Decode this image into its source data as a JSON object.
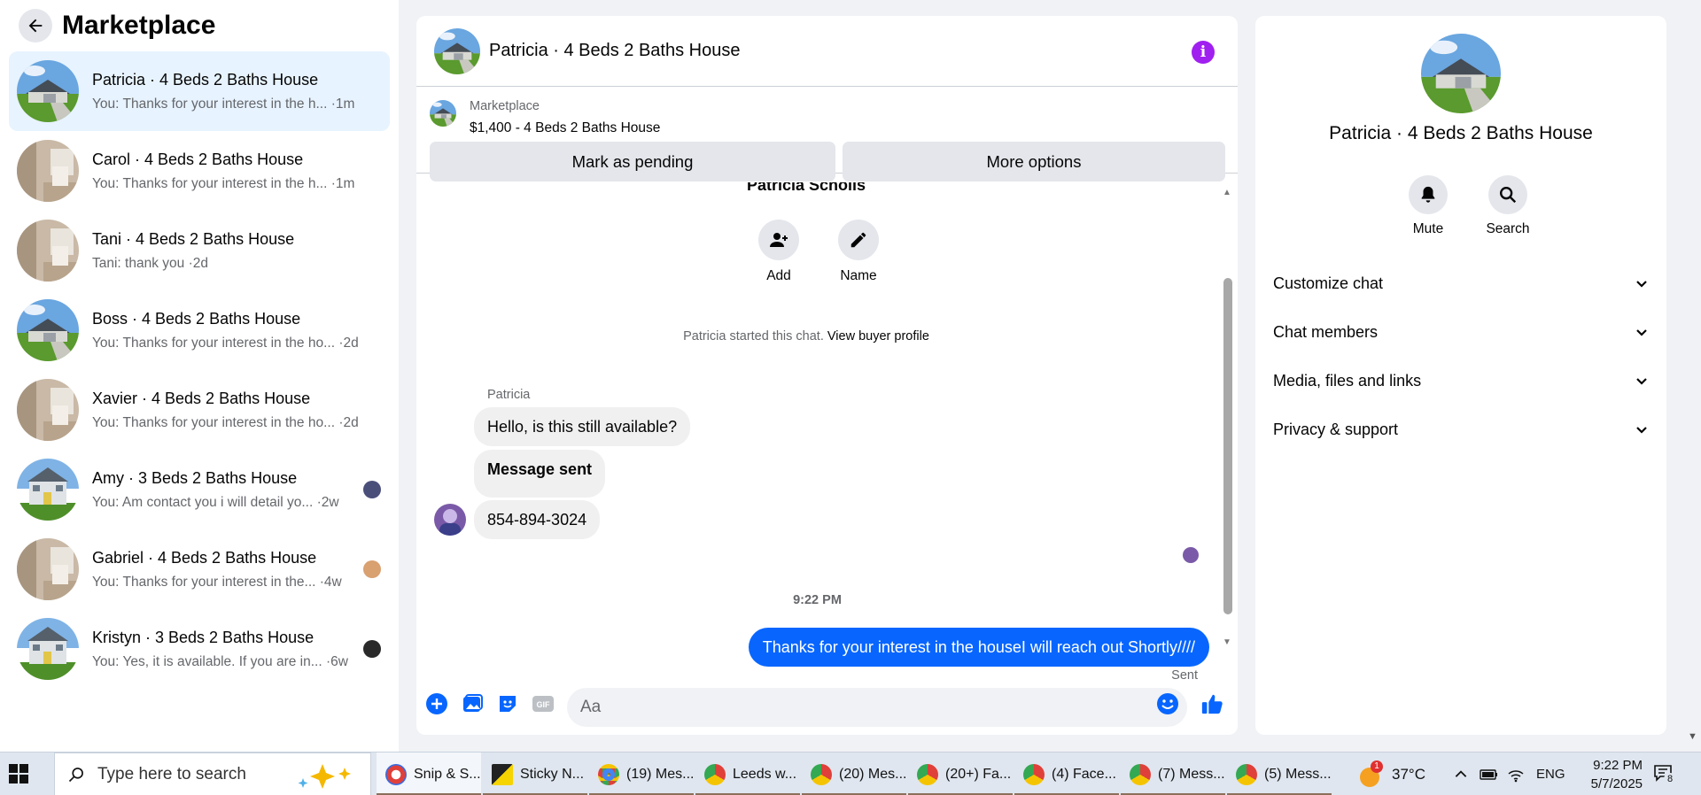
{
  "sidebar": {
    "title": "Marketplace",
    "conversations": [
      {
        "name": "Patricia · 4 Beds 2 Baths House",
        "preview": "You: Thanks for your interest in the h...",
        "time": "·1m"
      },
      {
        "name": "Carol · 4 Beds 2 Baths House",
        "preview": "You: Thanks for your interest in the h...",
        "time": "·1m"
      },
      {
        "name": "Tani · 4 Beds 2 Baths House",
        "preview": "Tani: thank you",
        "time": "·2d"
      },
      {
        "name": "Boss · 4 Beds 2 Baths House",
        "preview": "You: Thanks for your interest in the ho...",
        "time": "·2d"
      },
      {
        "name": "Xavier · 4 Beds 2 Baths House",
        "preview": "You: Thanks for your interest in the ho...",
        "time": "·2d"
      },
      {
        "name": "Amy · 3 Beds 2 Baths House",
        "preview": "You: Am contact you i will detail yo...",
        "time": "·2w"
      },
      {
        "name": "Gabriel · 4 Beds 2 Baths House",
        "preview": "You: Thanks for your interest in the...",
        "time": "·4w"
      },
      {
        "name": "Kristyn · 3 Beds 2 Baths House",
        "preview": "You: Yes, it is available. If you are in...",
        "time": "·6w"
      }
    ]
  },
  "chat": {
    "title": "Patricia · 4 Beds 2 Baths House",
    "listing": {
      "source": "Marketplace",
      "price_title": "$1,400 - 4 Beds 2 Baths House"
    },
    "mark_pending_label": "Mark as pending",
    "more_options_label": "More options",
    "partial_name": "Patricia Scholls",
    "actions": {
      "add_label": "Add",
      "name_label": "Name"
    },
    "started_text": "Patricia started this chat.",
    "view_profile_label": "View buyer profile",
    "sender_name": "Patricia",
    "messages": [
      "Hello, is this still available?",
      "Message sent",
      "854-894-3024"
    ],
    "time_divider": "9:22 PM",
    "sent_message": "Thanks for your interest in the houseI will reach out Shortly////",
    "sent_status": "Sent",
    "composer_placeholder": "Aa"
  },
  "info_panel": {
    "title": "Patricia · 4 Beds 2 Baths House",
    "mute_label": "Mute",
    "search_label": "Search",
    "sections": [
      "Customize chat",
      "Chat members",
      "Media, files and links",
      "Privacy & support"
    ]
  },
  "taskbar": {
    "search_placeholder": "Type here to search",
    "apps": [
      "Snip & S...",
      "Sticky N...",
      "(19) Mes...",
      "Leeds w...",
      "(20) Mes...",
      "(20+) Fa...",
      "(4) Face...",
      "(7) Mess...",
      "(5) Mess..."
    ],
    "weather": "37°C",
    "language": "ENG",
    "time": "9:22 PM",
    "date": "5/7/2025",
    "notification_count": "8",
    "weather_badge": "1"
  },
  "colors": {
    "accent": "#0866ff",
    "info_purple": "#a020f0",
    "active_row": "#e7f3ff"
  }
}
